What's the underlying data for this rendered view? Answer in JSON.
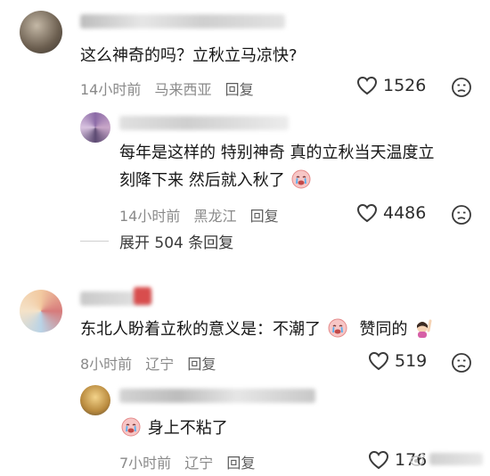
{
  "comments": [
    {
      "text": "这么神奇的吗？立秋立马凉快?",
      "time": "14小时前",
      "location": "马来西亚",
      "reply_label": "回复",
      "likes": "1526"
    },
    {
      "text_line1": "每年是这样的 特别神奇 真的立秋当天温度立",
      "text_line2": "刻降下来 然后就入秋了",
      "time": "14小时前",
      "location": "黑龙江",
      "reply_label": "回复",
      "likes": "4486"
    },
    {
      "text_part1": "东北人盼着立秋的意义是：不潮了",
      "text_part2": "赞同的",
      "time": "8小时前",
      "location": "辽宁",
      "reply_label": "回复",
      "likes": "519"
    },
    {
      "text": "身上不粘了",
      "time": "7小时前",
      "location": "辽宁",
      "reply_label": "回复",
      "likes": "176"
    }
  ],
  "expand_replies": "展开 504 条回复",
  "icons": {
    "like": "heart-outline-icon",
    "dislike": "frown-face-icon",
    "emoji_crying": "crying-face-emoji",
    "emoji_raise_hand": "woman-raising-hand-emoji"
  },
  "colors": {
    "meta_text": "#8a8a8a",
    "body_text": "#161616",
    "blur_name": "#d8d8d8"
  }
}
